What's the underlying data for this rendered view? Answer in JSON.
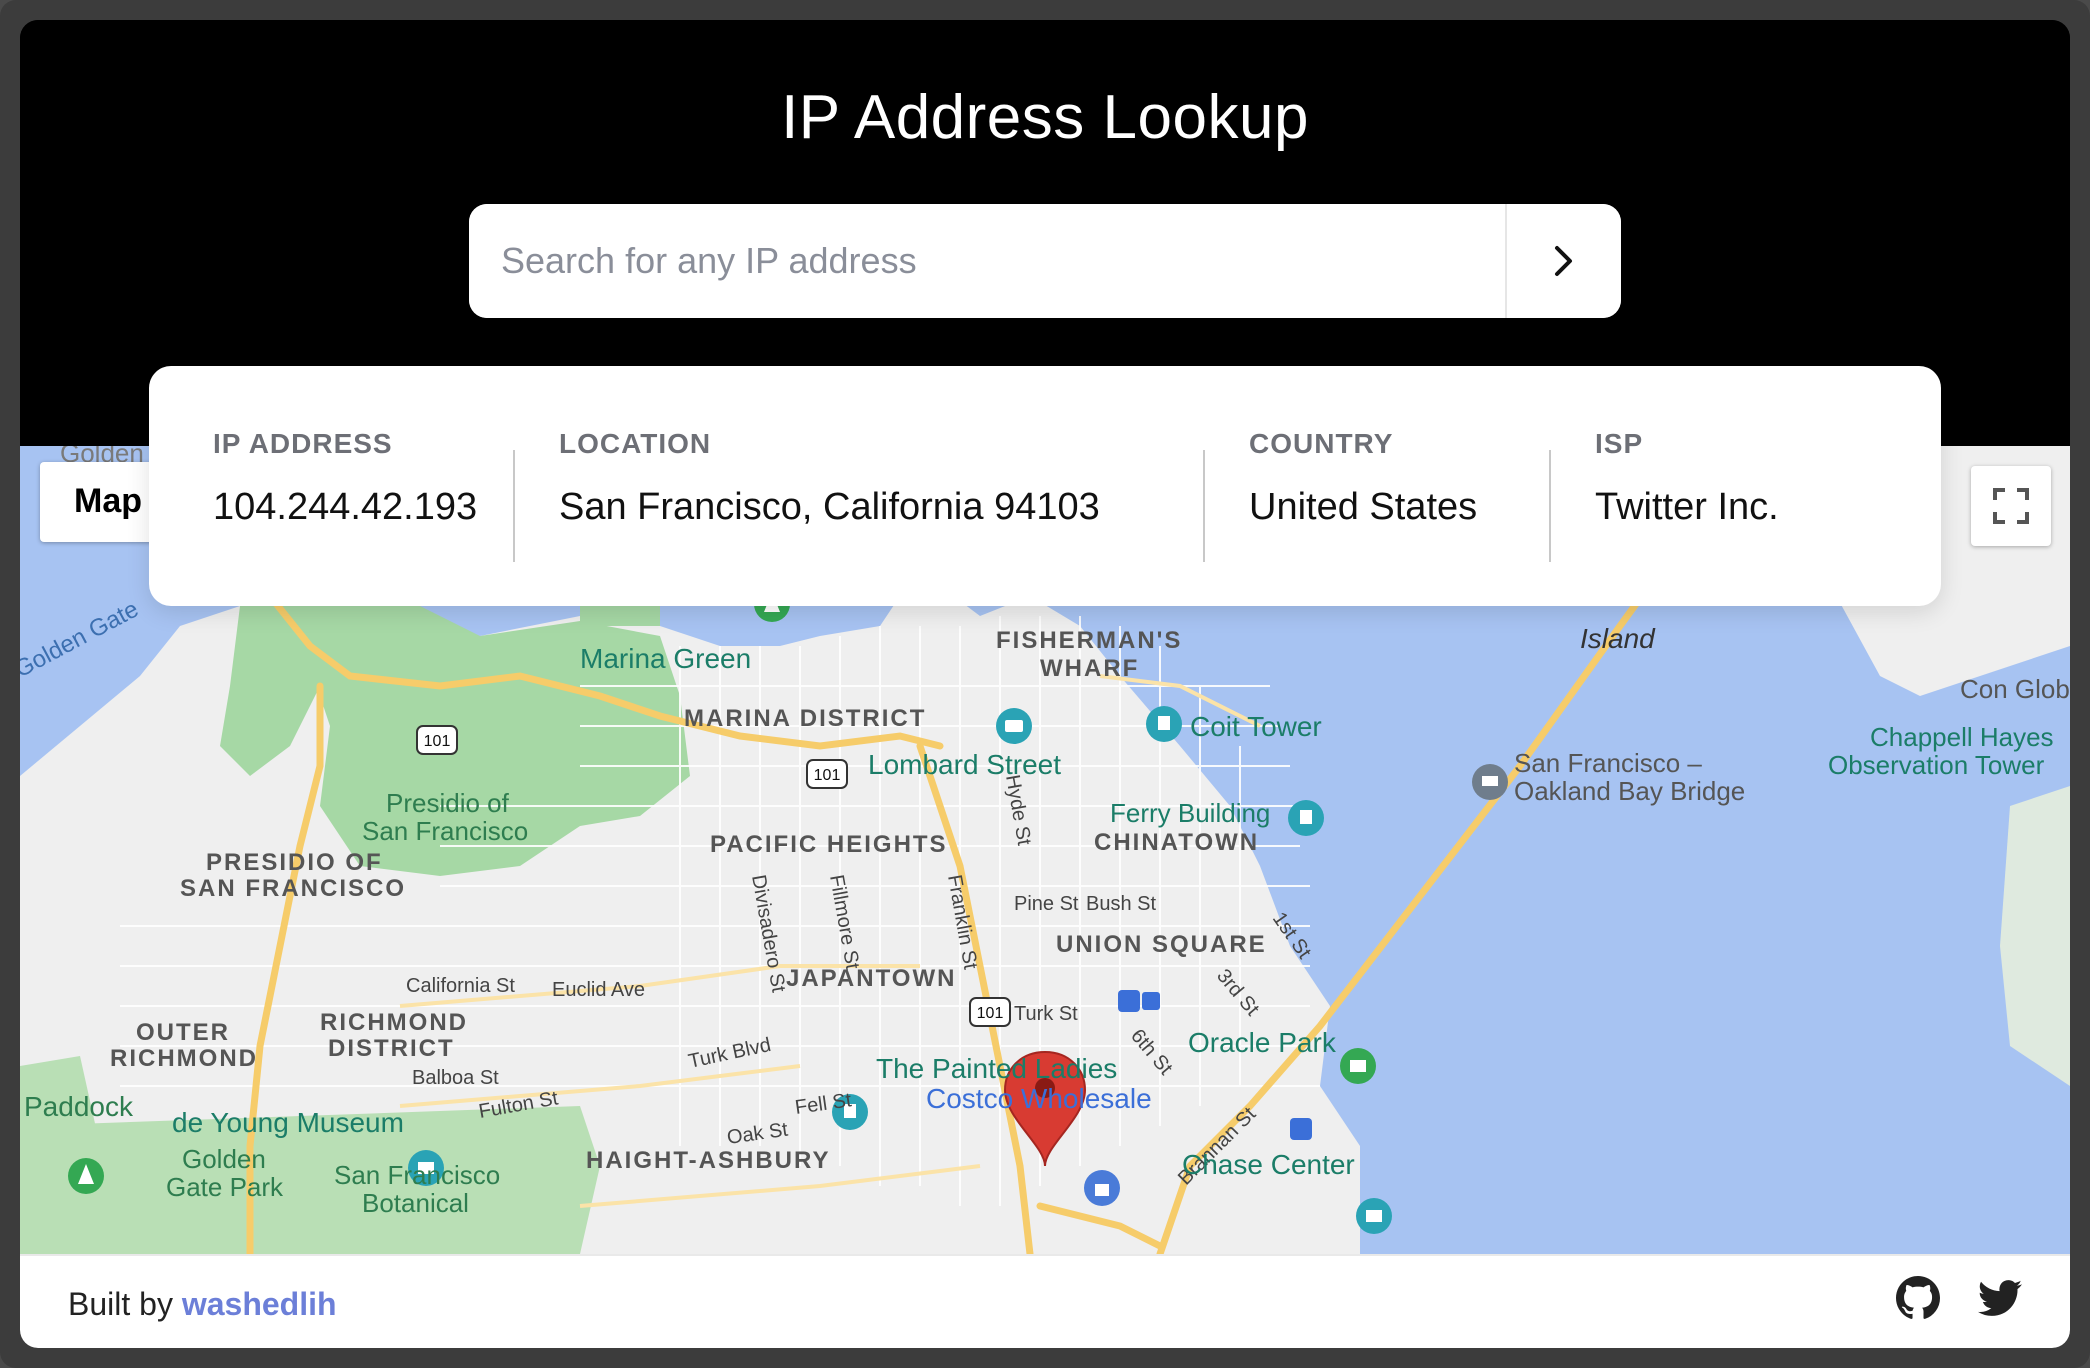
{
  "app": {
    "title": "IP Address Lookup"
  },
  "search": {
    "placeholder": "Search for any IP address",
    "value": "",
    "submit_icon": "chevron-right-icon"
  },
  "info": {
    "ip_address": {
      "label": "IP ADDRESS",
      "value": "104.244.42.193"
    },
    "location": {
      "label": "LOCATION",
      "value": "San Francisco, California 94103"
    },
    "country": {
      "label": "COUNTRY",
      "value": "United States"
    },
    "isp": {
      "label": "ISP",
      "value": "Twitter Inc."
    }
  },
  "map": {
    "type_button_label": "Map",
    "fullscreen_icon": "fullscreen-icon",
    "marker_icon": "map-pin-icon",
    "labels": {
      "golden_gate_top": "Golden",
      "golden_gate": "Golden Gate",
      "marina_green": "Marina Green",
      "fishermans_wharf_1": "FISHERMAN'S",
      "fishermans_wharf_2": "WHARF",
      "island": "Island",
      "con_glob": "Con Glob",
      "marina_district": "MARINA DISTRICT",
      "coit_tower": "Coit Tower",
      "chappell_1": "Chappell Hayes",
      "chappell_2": "Observation Tower",
      "lombard": "Lombard Street",
      "bay_bridge_1": "San Francisco –",
      "bay_bridge_2": "Oakland Bay Bridge",
      "presidio_park_1": "Presidio of",
      "presidio_park_2": "San Francisco",
      "ferry_building": "Ferry Building",
      "pacific_heights": "PACIFIC HEIGHTS",
      "chinatown": "CHINATOWN",
      "hyde_st": "Hyde St",
      "presidio_1": "PRESIDIO OF",
      "presidio_2": "SAN FRANCISCO",
      "pine_st": "Pine St",
      "bush_st": "Bush St",
      "divisadero": "Divisadero St",
      "fillmore": "Fillmore St",
      "franklin": "Franklin St",
      "union_square": "UNION SQUARE",
      "first_st": "1st St",
      "california_st": "California St",
      "euclid_ave": "Euclid Ave",
      "japantown": "JAPANTOWN",
      "third_st": "3rd St",
      "turk_st": "Turk St",
      "outer_richmond_1": "OUTER",
      "outer_richmond_2": "RICHMOND",
      "richmond_1": "RICHMOND",
      "richmond_2": "DISTRICT",
      "sixth_st": "6th St",
      "oracle_park": "Oracle Park",
      "turk_blvd": "Turk Blvd",
      "balboa_st": "Balboa St",
      "painted_ladies": "The Painted Ladies",
      "paddock": "Paddock",
      "costco": "Costco Wholesale",
      "de_young": "de Young Museum",
      "fulton_st": "Fulton St",
      "fell_st": "Fell St",
      "brannan_st": "Brannan St",
      "oak_st": "Oak St",
      "golden_gate_park_1": "Golden",
      "golden_gate_park_2": "Gate Park",
      "sf_botanical_1": "San Francisco",
      "sf_botanical_2": "Botanical",
      "haight_ashbury": "HAIGHT-ASHBURY",
      "chase_center": "Chase Center",
      "hwy_101": "101"
    }
  },
  "footer": {
    "built_by_prefix": "Built by",
    "author": "washedlih",
    "github_icon": "github-icon",
    "twitter_icon": "twitter-icon"
  },
  "colors": {
    "header_bg": "#000000",
    "water": "#a7c3f2",
    "land": "#f2f2f2",
    "park": "#a6d8a5",
    "road": "#f6cc6a",
    "marker": "#d83b32",
    "poi_text": "#1b7d68",
    "link": "#6c7fd8"
  }
}
